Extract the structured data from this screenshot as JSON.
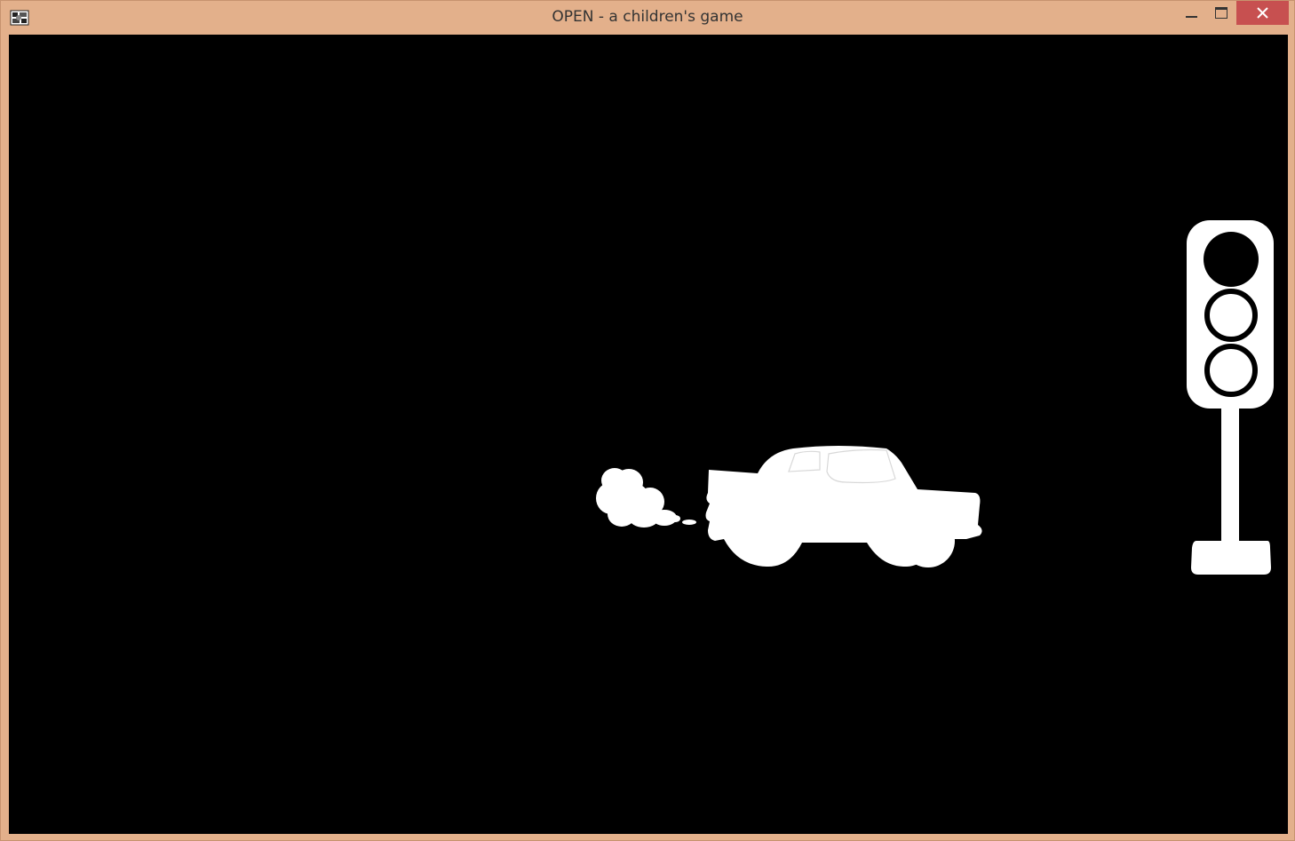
{
  "window": {
    "title": "OPEN - a children's game",
    "frame_color": "#e3b08b",
    "close_color": "#c75050"
  },
  "controls": {
    "minimize_icon": "minimize-icon",
    "maximize_icon": "maximize-icon",
    "close_icon": "close-icon"
  },
  "scene": {
    "background": "#000000",
    "sprite_color": "#ffffff",
    "traffic_light": {
      "lights": [
        {
          "position": "top",
          "state": "filled"
        },
        {
          "position": "middle",
          "state": "outline"
        },
        {
          "position": "bottom",
          "state": "outline"
        }
      ]
    },
    "car": {
      "icon": "car-icon"
    },
    "exhaust": {
      "icon": "exhaust-smoke-icon"
    }
  }
}
